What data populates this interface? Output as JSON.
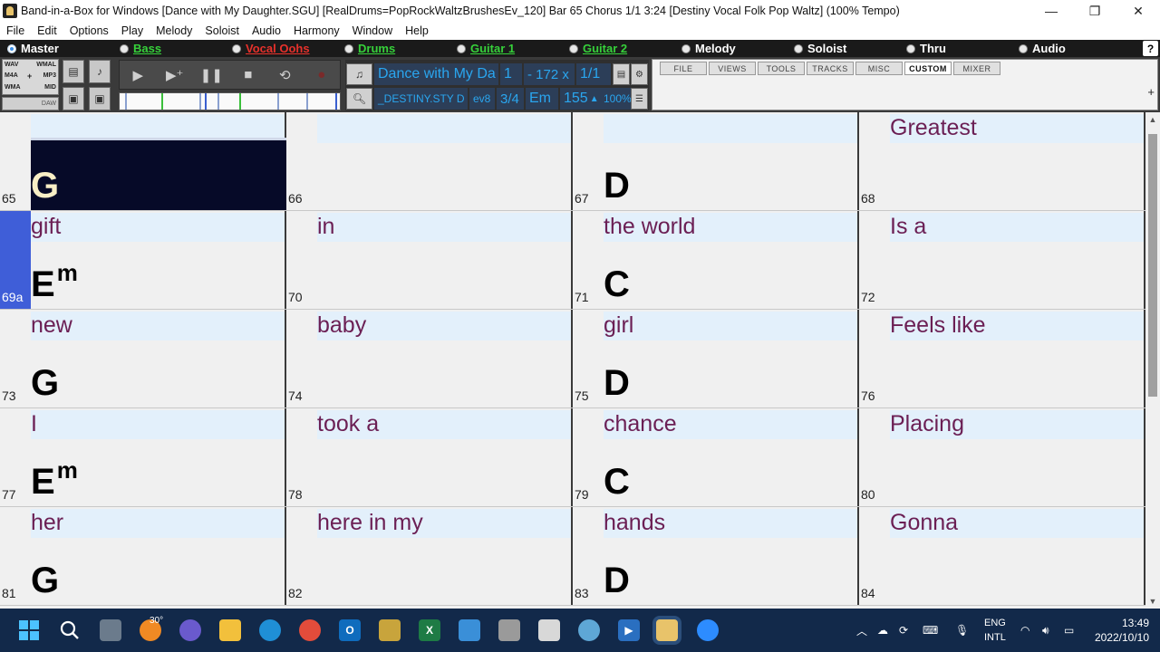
{
  "window": {
    "title": "Band-in-a-Box for Windows  [Dance with My Daughter.SGU] [RealDrums=PopRockWaltzBrushesEv_120] Bar 65 Chorus 1/1  3:24  [Destiny Vocal Folk Pop Waltz] (100% Tempo)",
    "minimize": "—",
    "restore": "❐",
    "close": "✕"
  },
  "menu": [
    "File",
    "Edit",
    "Options",
    "Play",
    "Melody",
    "Soloist",
    "Audio",
    "Harmony",
    "Window",
    "Help"
  ],
  "tracks": [
    {
      "label": "Master",
      "style": "white",
      "selected": true
    },
    {
      "label": "Bass",
      "style": "green",
      "selected": false
    },
    {
      "label": "Vocal Oohs",
      "style": "red",
      "selected": false
    },
    {
      "label": "Drums",
      "style": "green",
      "selected": false
    },
    {
      "label": "Guitar 1",
      "style": "green",
      "selected": false
    },
    {
      "label": "Guitar 2",
      "style": "green",
      "selected": false
    },
    {
      "label": "Melody",
      "style": "white",
      "selected": false
    },
    {
      "label": "Soloist",
      "style": "white",
      "selected": false
    },
    {
      "label": "Thru",
      "style": "white",
      "selected": false
    },
    {
      "label": "Audio",
      "style": "white",
      "selected": false
    }
  ],
  "help_label": "?",
  "formats": {
    "wav": "WAV",
    "wmal": "WMAL",
    "m4a": "M4A",
    "mp3": "MP3",
    "wma": "WMA",
    "mid": "MID",
    "plus": "+",
    "daw": "DAW"
  },
  "song": {
    "title": "Dance with My Da",
    "chorus_start": "1",
    "range": "- 172 x",
    "chorus_count": "1/1",
    "style": "_DESTINY.STY D",
    "style_suffix": "ev8",
    "time_sig": "3/4",
    "key": "Em",
    "tempo": "155",
    "tempo_pct": "100%"
  },
  "tabs": [
    {
      "label": "FILE",
      "active": false
    },
    {
      "label": "VIEWS",
      "active": false
    },
    {
      "label": "TOOLS",
      "active": false
    },
    {
      "label": "TRACKS",
      "active": false
    },
    {
      "label": "MISC",
      "active": false
    },
    {
      "label": "CUSTOM",
      "active": true
    },
    {
      "label": "MIXER",
      "active": false
    }
  ],
  "plus_label": "+",
  "sheet": {
    "rows": [
      {
        "cells": [
          {
            "bar": "65",
            "chord": "G",
            "sup": "",
            "lyric": "",
            "selected": true
          },
          {
            "bar": "66",
            "chord": "",
            "sup": "",
            "lyric": ""
          },
          {
            "bar": "67",
            "chord": "D",
            "sup": "",
            "lyric": ""
          },
          {
            "bar": "68",
            "chord": "",
            "sup": "",
            "lyric": "Greatest"
          }
        ]
      },
      {
        "cells": [
          {
            "bar": "69a",
            "chord": "E",
            "sup": "m",
            "lyric": "gift",
            "current": true
          },
          {
            "bar": "70",
            "chord": "",
            "sup": "",
            "lyric": "in"
          },
          {
            "bar": "71",
            "chord": "C",
            "sup": "",
            "lyric": "the world"
          },
          {
            "bar": "72",
            "chord": "",
            "sup": "",
            "lyric": "Is a"
          }
        ]
      },
      {
        "cells": [
          {
            "bar": "73",
            "chord": "G",
            "sup": "",
            "lyric": "new"
          },
          {
            "bar": "74",
            "chord": "",
            "sup": "",
            "lyric": "baby"
          },
          {
            "bar": "75",
            "chord": "D",
            "sup": "",
            "lyric": "girl"
          },
          {
            "bar": "76",
            "chord": "",
            "sup": "",
            "lyric": "Feels like"
          }
        ]
      },
      {
        "cells": [
          {
            "bar": "77",
            "chord": "E",
            "sup": "m",
            "lyric": "I"
          },
          {
            "bar": "78",
            "chord": "",
            "sup": "",
            "lyric": "took a"
          },
          {
            "bar": "79",
            "chord": "C",
            "sup": "",
            "lyric": "chance"
          },
          {
            "bar": "80",
            "chord": "",
            "sup": "",
            "lyric": "Placing"
          }
        ]
      },
      {
        "cells": [
          {
            "bar": "81",
            "chord": "G",
            "sup": "",
            "lyric": "her"
          },
          {
            "bar": "82",
            "chord": "",
            "sup": "",
            "lyric": "here in my"
          },
          {
            "bar": "83",
            "chord": "D",
            "sup": "",
            "lyric": "hands"
          },
          {
            "bar": "84",
            "chord": "",
            "sup": "",
            "lyric": "Gonna"
          }
        ]
      }
    ]
  },
  "taskbar": {
    "weather_temp": "30°",
    "lang_line1": "ENG",
    "lang_line2": "INTL",
    "time": "13:49",
    "date": "2022/10/10"
  },
  "colors": {
    "lyric": "#6b1f54",
    "accent_blue": "#2aa6ef",
    "track_green": "#36d13a",
    "track_red": "#e8312b",
    "taskbar": "#12294a",
    "current_bar": "#3f5ed8"
  }
}
